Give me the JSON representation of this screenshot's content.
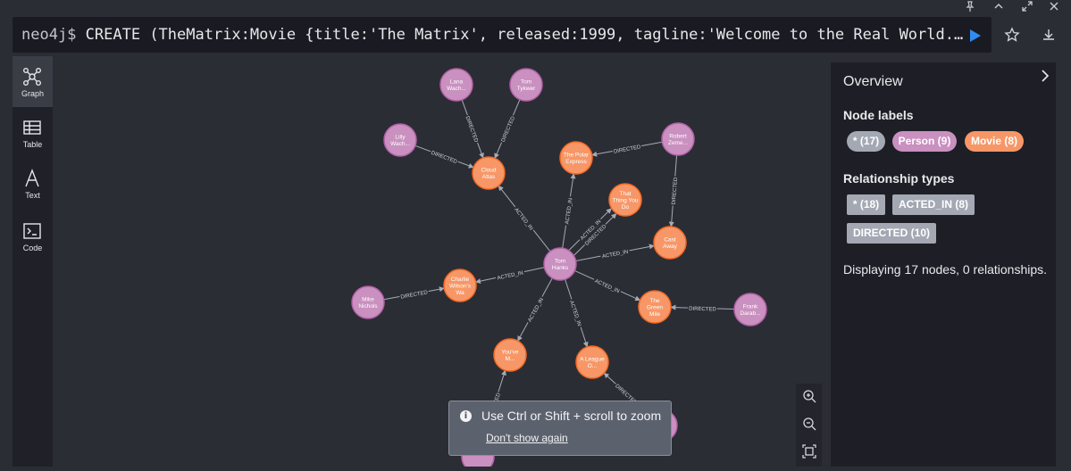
{
  "editor": {
    "prompt": "neo4j$",
    "query": "CREATE (TheMatrix:Movie {title:'The Matrix', released:1999, tagline:'Welcome to the Real World...",
    "icons": [
      "pin-icon",
      "chevron-up-icon",
      "expand-icon",
      "close-icon",
      "play-icon",
      "star-icon",
      "download-icon"
    ]
  },
  "sidebar": {
    "items": [
      {
        "label": "Graph",
        "icon": "graph-icon"
      },
      {
        "label": "Table",
        "icon": "table-icon"
      },
      {
        "label": "Text",
        "icon": "text-icon"
      },
      {
        "label": "Code",
        "icon": "code-icon"
      }
    ]
  },
  "graph": {
    "colors": {
      "person": "#c990c0",
      "movie": "#f79767",
      "edge": "#a5abb6",
      "edge_label": "#d0d3da"
    },
    "nodes": [
      {
        "id": "lana",
        "type": "person",
        "lines": [
          "Lana",
          "Wach..."
        ]
      },
      {
        "id": "tomt",
        "type": "person",
        "lines": [
          "Tom",
          "Tykwer"
        ]
      },
      {
        "id": "lilly",
        "type": "person",
        "lines": [
          "Lilly",
          "Wach..."
        ]
      },
      {
        "id": "robert",
        "type": "person",
        "lines": [
          "Robert",
          "Zeme..."
        ]
      },
      {
        "id": "tomh",
        "type": "person",
        "lines": [
          "Tom",
          "Hanks"
        ]
      },
      {
        "id": "mike",
        "type": "person",
        "lines": [
          "Mike",
          "Nichols"
        ]
      },
      {
        "id": "frank",
        "type": "person",
        "lines": [
          "Frank",
          "Darab..."
        ]
      },
      {
        "id": "p8",
        "type": "person",
        "lines": []
      },
      {
        "id": "p9",
        "type": "person",
        "lines": []
      },
      {
        "id": "cloud",
        "type": "movie",
        "lines": [
          "Cloud",
          "Atlas"
        ]
      },
      {
        "id": "polar",
        "type": "movie",
        "lines": [
          "The Polar",
          "Express"
        ]
      },
      {
        "id": "thing",
        "type": "movie",
        "lines": [
          "That",
          "Thing You",
          "Do"
        ]
      },
      {
        "id": "cast",
        "type": "movie",
        "lines": [
          "Cast",
          "Away"
        ]
      },
      {
        "id": "charlie",
        "type": "movie",
        "lines": [
          "Charlie",
          "Wilson's",
          "Wa"
        ]
      },
      {
        "id": "green",
        "type": "movie",
        "lines": [
          "The",
          "Green",
          "Mile"
        ]
      },
      {
        "id": "youve",
        "type": "movie",
        "lines": [
          "You've",
          "M..."
        ]
      },
      {
        "id": "league",
        "type": "movie",
        "lines": [
          "A League",
          "O..."
        ]
      }
    ],
    "edges": [
      {
        "from": "lana",
        "to": "cloud",
        "label": "DIRECTED"
      },
      {
        "from": "tomt",
        "to": "cloud",
        "label": "DIRECTED"
      },
      {
        "from": "lilly",
        "to": "cloud",
        "label": "DIRECTED"
      },
      {
        "from": "robert",
        "to": "polar",
        "label": "DIRECTED"
      },
      {
        "from": "robert",
        "to": "cast",
        "label": "DIRECTED"
      },
      {
        "from": "tomh",
        "to": "cloud",
        "label": "ACTED_IN"
      },
      {
        "from": "tomh",
        "to": "polar",
        "label": "ACTED_IN"
      },
      {
        "from": "tomh",
        "to": "thing",
        "label": "ACTED_IN"
      },
      {
        "from": "tomh",
        "to": "thing",
        "label": "DIRECTED"
      },
      {
        "from": "tomh",
        "to": "cast",
        "label": "ACTED_IN"
      },
      {
        "from": "tomh",
        "to": "charlie",
        "label": "ACTED_IN"
      },
      {
        "from": "tomh",
        "to": "green",
        "label": "ACTED_IN"
      },
      {
        "from": "tomh",
        "to": "youve",
        "label": "ACTED_IN"
      },
      {
        "from": "tomh",
        "to": "league",
        "label": "ACTED_IN"
      },
      {
        "from": "mike",
        "to": "charlie",
        "label": "DIRECTED"
      },
      {
        "from": "frank",
        "to": "green",
        "label": "DIRECTED"
      },
      {
        "from": "p8",
        "to": "league",
        "label": "DIRECTED"
      },
      {
        "from": "p9",
        "to": "youve",
        "label": "DIRECTED"
      }
    ]
  },
  "zoom": {
    "icons": [
      "zoom-in-icon",
      "zoom-out-icon",
      "fit-icon"
    ]
  },
  "toast": {
    "message": "Use Ctrl or Shift + scroll to zoom",
    "link": "Don't show again"
  },
  "overview": {
    "title": "Overview",
    "node_labels_title": "Node labels",
    "node_labels": [
      {
        "text": "* (17)",
        "kind": "grey"
      },
      {
        "text": "Person (9)",
        "kind": "person"
      },
      {
        "text": "Movie (8)",
        "kind": "movie"
      }
    ],
    "rel_types_title": "Relationship types",
    "rel_types": [
      "* (18)",
      "ACTED_IN (8)",
      "DIRECTED (10)"
    ],
    "description": "Displaying 17 nodes, 0 relationships."
  }
}
